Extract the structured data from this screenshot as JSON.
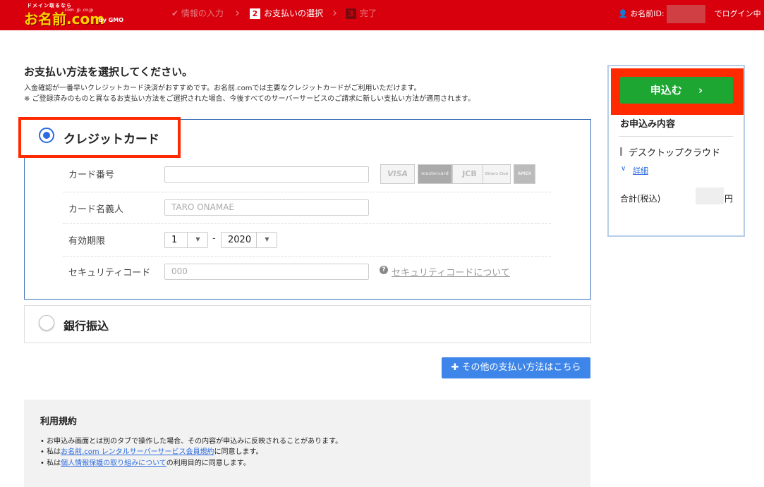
{
  "header": {
    "logo_tagline": "ドメイン取るなら",
    "logo_text": "お名前.com",
    "logo_domains": ".com .jp .co.jp",
    "logo_gmo": "by GMO",
    "steps": [
      {
        "num": "",
        "label": "情報の入力"
      },
      {
        "num": "2",
        "label": "お支払いの選択"
      },
      {
        "num": "3",
        "label": "完了"
      }
    ],
    "user_prefix": "お名前ID:",
    "user_suffix": "でログイン中"
  },
  "main": {
    "title": "お支払い方法を選択してください。",
    "desc_lines": [
      "入金確認が一番早いクレジットカード決済がおすすめです。お名前.comでは主要なクレジットカードがご利用いただけます。",
      "※ ご登録済みのものと異なるお支払い方法をご選択された場合、今後すべてのサーバーサービスのご請求に新しい支払い方法が適用されます。"
    ]
  },
  "credit_card": {
    "label": "クレジットカード",
    "selected": true,
    "fields": {
      "number_label": "カード番号",
      "number_value": "",
      "holder_label": "カード名義人",
      "holder_placeholder": "TARO ONAMAE",
      "expiry_label": "有効期限",
      "expiry_month": "1",
      "expiry_year": "2020",
      "expiry_separator": "-",
      "security_label": "セキュリティコード",
      "security_placeholder": "000",
      "security_help": "セキュリティコードについて"
    },
    "brands": [
      "VISA",
      "mastercard",
      "JCB",
      "Diners Club",
      "AMEX"
    ]
  },
  "bank": {
    "label": "銀行振込",
    "selected": false
  },
  "other_payment_button": "その他の支払い方法はこちら",
  "terms": {
    "title": "利用規約",
    "items": [
      {
        "pre": "お申込み画面とは別のタブで操作した場合、その内容が申込みに反映されることがあります。",
        "link": "",
        "post": ""
      },
      {
        "pre": "私は",
        "link": "お名前.com レンタルサーバーサービス会員規約",
        "post": "に同意します。"
      },
      {
        "pre": "私は",
        "link": "個人情報保護の取り組みについて",
        "post": "の利用目的に同意します。"
      }
    ]
  },
  "sidebar": {
    "apply_button": "申込む",
    "title": "お申込み内容",
    "item": "デスクトップクラウド",
    "detail_link": "詳細",
    "total_label": "合計(税込)",
    "total_suffix": "円"
  },
  "colors": {
    "header_bg": "#d8000c",
    "accent_blue": "#2c6be0",
    "apply_green": "#1ea633",
    "highlight_red": "#ff2a00"
  }
}
